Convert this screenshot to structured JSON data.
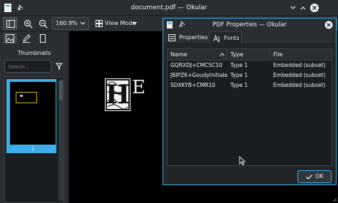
{
  "window": {
    "title": "document.pdf — Okular"
  },
  "toolbar": {
    "zoom_value": "160.9%",
    "view_mode_label": "View Mode"
  },
  "sidebar": {
    "thumbnails_label": "Thumbnails",
    "search_placeholder": "Search...",
    "thumbnail_page_number": "1"
  },
  "page": {
    "initial_letter": "H",
    "following_letter": "E"
  },
  "dialog": {
    "title": "PDF Properties — Okular",
    "tabs": [
      {
        "label": "Properties"
      },
      {
        "label": "Fonts"
      }
    ],
    "columns": [
      "Name",
      "Type",
      "File"
    ],
    "fonts": [
      {
        "name": "GQRXDJ+CMCSC10",
        "type": "Type 1",
        "file": "Embedded (subset)"
      },
      {
        "name": "JBIPZK+GoudyInitialen",
        "type": "Type 1",
        "file": "Embedded (subset)"
      },
      {
        "name": "SDXKYB+CMR10",
        "type": "Type 1",
        "file": "Embedded (subset)"
      }
    ],
    "ok_label": "OK"
  },
  "colors": {
    "accent": "#3daee9",
    "window_bg": "#232629",
    "panel_bg": "#2a2e32",
    "text": "#eff0f1"
  }
}
